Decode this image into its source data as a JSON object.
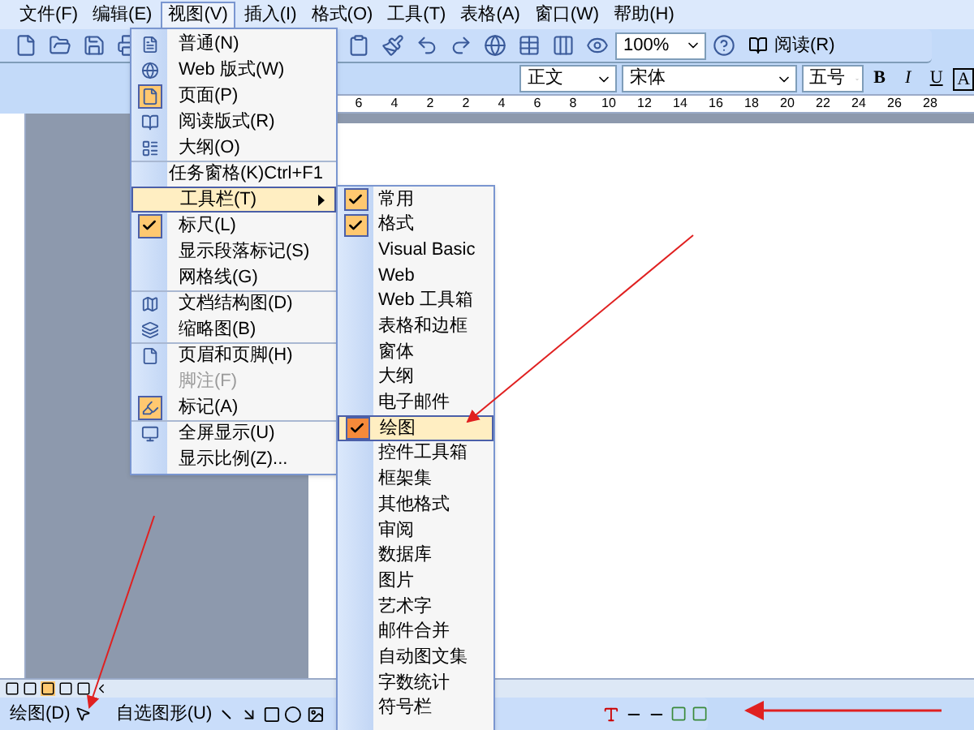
{
  "menubar": [
    {
      "label": "文件(F)",
      "selected": false
    },
    {
      "label": "编辑(E)",
      "selected": false
    },
    {
      "label": "视图(V)",
      "selected": true
    },
    {
      "label": "插入(I)",
      "selected": false
    },
    {
      "label": "格式(O)",
      "selected": false
    },
    {
      "label": "工具(T)",
      "selected": false
    },
    {
      "label": "表格(A)",
      "selected": false
    },
    {
      "label": "窗口(W)",
      "selected": false
    },
    {
      "label": "帮助(H)",
      "selected": false
    }
  ],
  "standard_toolbar": {
    "zoom": "100%",
    "read_button": "阅读(R)"
  },
  "format_toolbar": {
    "style": "正文",
    "font": "宋体",
    "size": "五号",
    "bold": "B",
    "italic": "I",
    "underline": "U",
    "char_border": "A"
  },
  "ruler": {
    "labels": [
      "6",
      "4",
      "2",
      "2",
      "4",
      "6",
      "8",
      "10",
      "12",
      "14",
      "16",
      "18",
      "20",
      "22",
      "24",
      "26",
      "28"
    ]
  },
  "view_menu": [
    {
      "label": "普通(N)",
      "kind": "icon",
      "checked": false,
      "disabled": false,
      "group_start": false,
      "submenu": false,
      "selected": false
    },
    {
      "label": "Web 版式(W)",
      "kind": "icon",
      "checked": false,
      "disabled": false,
      "group_start": false,
      "submenu": false,
      "selected": false
    },
    {
      "label": "页面(P)",
      "kind": "icon",
      "checked": true,
      "disabled": false,
      "group_start": false,
      "submenu": false,
      "selected": false
    },
    {
      "label": "阅读版式(R)",
      "kind": "icon",
      "checked": false,
      "disabled": false,
      "group_start": false,
      "submenu": false,
      "selected": false
    },
    {
      "label": "大纲(O)",
      "kind": "icon",
      "checked": false,
      "disabled": false,
      "group_start": false,
      "submenu": false,
      "selected": false
    },
    {
      "label": "任务窗格(K)",
      "shortcut": "Ctrl+F1",
      "kind": "plain",
      "checked": false,
      "disabled": false,
      "group_start": true,
      "submenu": false,
      "selected": false
    },
    {
      "label": "工具栏(T)",
      "kind": "plain",
      "checked": false,
      "disabled": false,
      "group_start": false,
      "submenu": true,
      "selected": true
    },
    {
      "label": "标尺(L)",
      "kind": "plain",
      "checked": true,
      "disabled": false,
      "group_start": false,
      "submenu": false,
      "selected": false
    },
    {
      "label": "显示段落标记(S)",
      "kind": "plain",
      "checked": false,
      "disabled": false,
      "group_start": false,
      "submenu": false,
      "selected": false
    },
    {
      "label": "网格线(G)",
      "kind": "plain",
      "checked": false,
      "disabled": false,
      "group_start": false,
      "submenu": false,
      "selected": false
    },
    {
      "label": "文档结构图(D)",
      "kind": "icon",
      "checked": false,
      "disabled": false,
      "group_start": true,
      "submenu": false,
      "selected": false
    },
    {
      "label": "缩略图(B)",
      "kind": "icon",
      "checked": false,
      "disabled": false,
      "group_start": false,
      "submenu": false,
      "selected": false
    },
    {
      "label": "页眉和页脚(H)",
      "kind": "icon",
      "checked": false,
      "disabled": false,
      "group_start": true,
      "submenu": false,
      "selected": false
    },
    {
      "label": "脚注(F)",
      "kind": "plain",
      "checked": false,
      "disabled": true,
      "group_start": false,
      "submenu": false,
      "selected": false
    },
    {
      "label": "标记(A)",
      "kind": "icon",
      "checked": true,
      "disabled": false,
      "group_start": false,
      "submenu": false,
      "selected": false
    },
    {
      "label": "全屏显示(U)",
      "kind": "icon",
      "checked": false,
      "disabled": false,
      "group_start": true,
      "submenu": false,
      "selected": false
    },
    {
      "label": "显示比例(Z)...",
      "kind": "plain",
      "checked": false,
      "disabled": false,
      "group_start": false,
      "submenu": false,
      "selected": false
    }
  ],
  "toolbars_submenu": [
    {
      "label": "常用",
      "checked": true,
      "selected": false
    },
    {
      "label": "格式",
      "checked": true,
      "selected": false
    },
    {
      "label": "Visual Basic",
      "checked": false,
      "selected": false
    },
    {
      "label": "Web",
      "checked": false,
      "selected": false
    },
    {
      "label": "Web 工具箱",
      "checked": false,
      "selected": false
    },
    {
      "label": "表格和边框",
      "checked": false,
      "selected": false
    },
    {
      "label": "窗体",
      "checked": false,
      "selected": false
    },
    {
      "label": "大纲",
      "checked": false,
      "selected": false
    },
    {
      "label": "电子邮件",
      "checked": false,
      "selected": false
    },
    {
      "label": "绘图",
      "checked": true,
      "selected": true
    },
    {
      "label": "控件工具箱",
      "checked": false,
      "selected": false
    },
    {
      "label": "框架集",
      "checked": false,
      "selected": false
    },
    {
      "label": "其他格式",
      "checked": false,
      "selected": false
    },
    {
      "label": "审阅",
      "checked": false,
      "selected": false
    },
    {
      "label": "数据库",
      "checked": false,
      "selected": false
    },
    {
      "label": "图片",
      "checked": false,
      "selected": false
    },
    {
      "label": "艺术字",
      "checked": false,
      "selected": false
    },
    {
      "label": "邮件合并",
      "checked": false,
      "selected": false
    },
    {
      "label": "自动图文集",
      "checked": false,
      "selected": false
    },
    {
      "label": "字数统计",
      "checked": false,
      "selected": false
    },
    {
      "label": "符号栏",
      "checked": false,
      "selected": false
    }
  ],
  "drawing_toolbar": {
    "draw_menu": "绘图(D)",
    "autoshapes_menu": "自选图形(U)"
  }
}
